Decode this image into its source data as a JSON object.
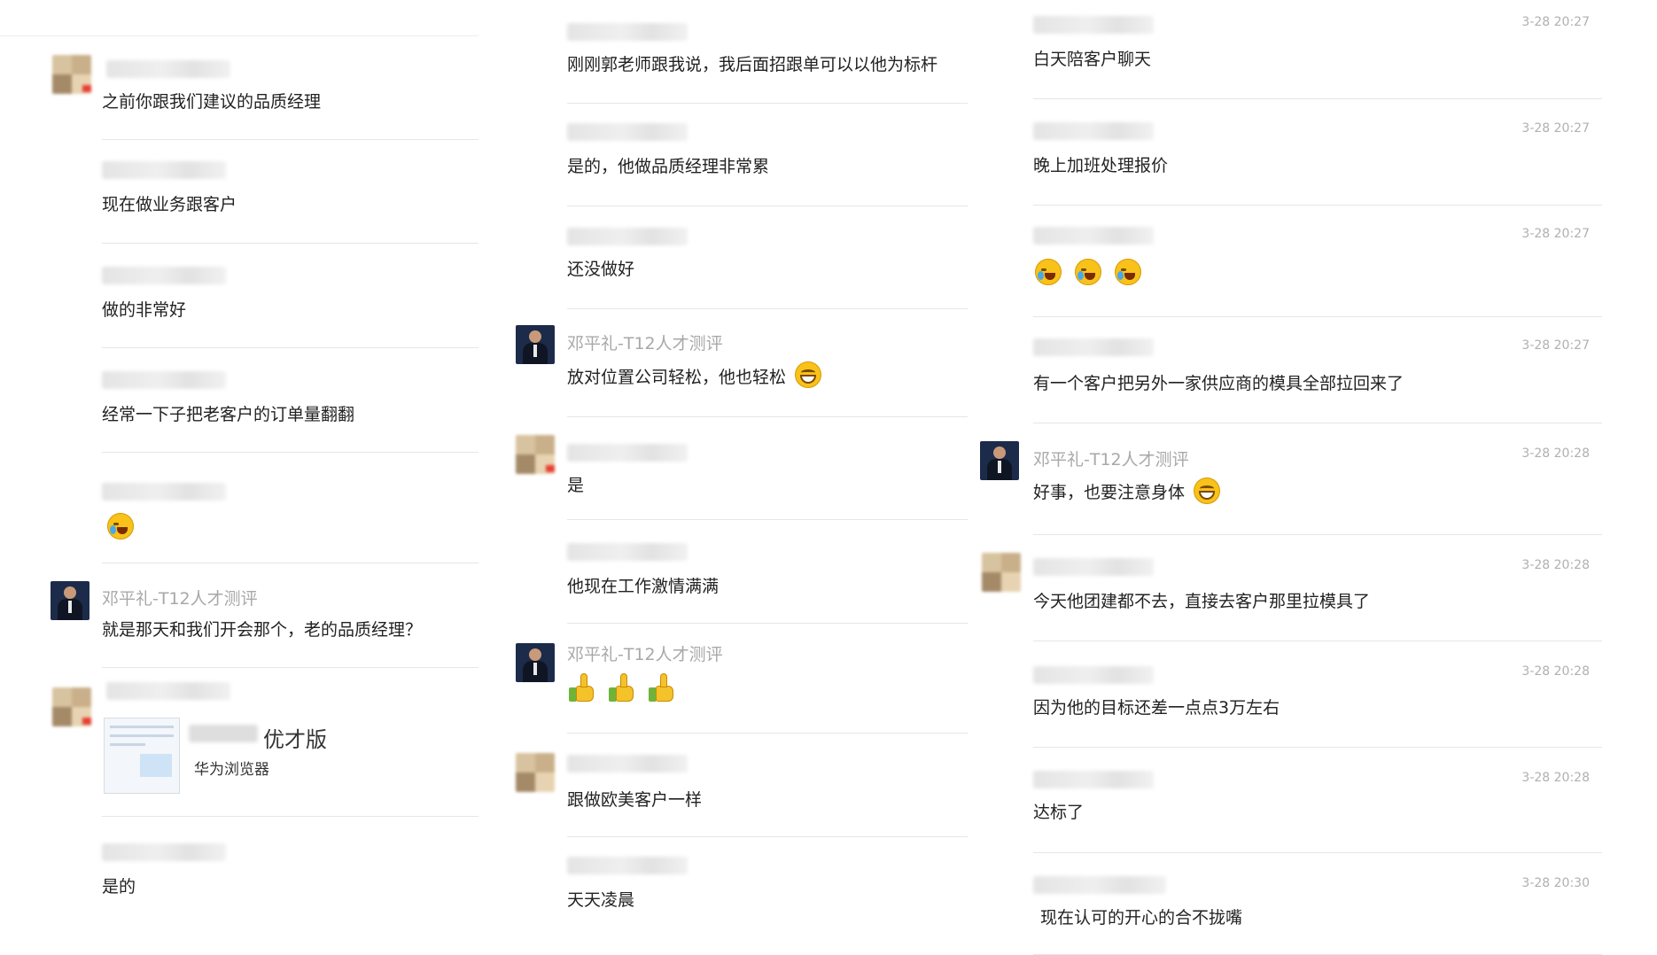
{
  "col1": [
    {
      "text": "之前你跟我们建议的品质经理",
      "avatar": "mosaic"
    },
    {
      "text": "现在做业务跟客户"
    },
    {
      "text": "做的非常好"
    },
    {
      "text": "经常一下子把老客户的订单量翻翻"
    },
    {
      "emoji": "cry"
    },
    {
      "sender": "邓平礼-T12人才测评",
      "text": "就是那天和我们开会那个，老的品质经理？",
      "avatar": "photo"
    },
    {
      "card": {
        "title": "优才版",
        "subtitle": "华为浏览器"
      },
      "avatar": "mosaic"
    },
    {
      "text": "是的"
    }
  ],
  "col2": [
    {
      "text": "刚刚郭老师跟我说，我后面招跟单可以以他为标杆"
    },
    {
      "text": "是的，他做品质经理非常累"
    },
    {
      "text": "还没做好"
    },
    {
      "sender": "邓平礼-T12人才测评",
      "text": "放对位置公司轻松，他也轻松",
      "emoji": "grin",
      "avatar": "photo"
    },
    {
      "text": "是",
      "avatar": "mosaic"
    },
    {
      "text": "他现在工作激情满满"
    },
    {
      "sender": "邓平礼-T12人才测评",
      "thumbs": 3,
      "avatar": "photo"
    },
    {
      "text": "跟做欧美客户一样",
      "avatar": "mosaic"
    },
    {
      "text": "天天凌晨"
    }
  ],
  "col3": [
    {
      "text": "白天陪客户聊天",
      "time": "3-28 20:27"
    },
    {
      "text": "晚上加班处理报价",
      "time": "3-28 20:27"
    },
    {
      "emojis": [
        "cry",
        "cry",
        "cry"
      ],
      "time": "3-28 20:27"
    },
    {
      "text": "有一个客户把另外一家供应商的模具全部拉回来了",
      "time": "3-28 20:27"
    },
    {
      "sender": "邓平礼-T12人才测评",
      "text": "好事，也要注意身体",
      "emoji": "grin",
      "time": "3-28 20:28",
      "avatar": "photo"
    },
    {
      "text": "今天他团建都不去，直接去客户那里拉模具了",
      "time": "3-28 20:28",
      "avatar": "mosaic"
    },
    {
      "text": "因为他的目标还差一点点3万左右",
      "time": "3-28 20:28"
    },
    {
      "text": "达标了",
      "time": "3-28 20:28"
    },
    {
      "text": "现在认可的开心的合不拢嘴",
      "time": "3-28 20:30"
    }
  ]
}
